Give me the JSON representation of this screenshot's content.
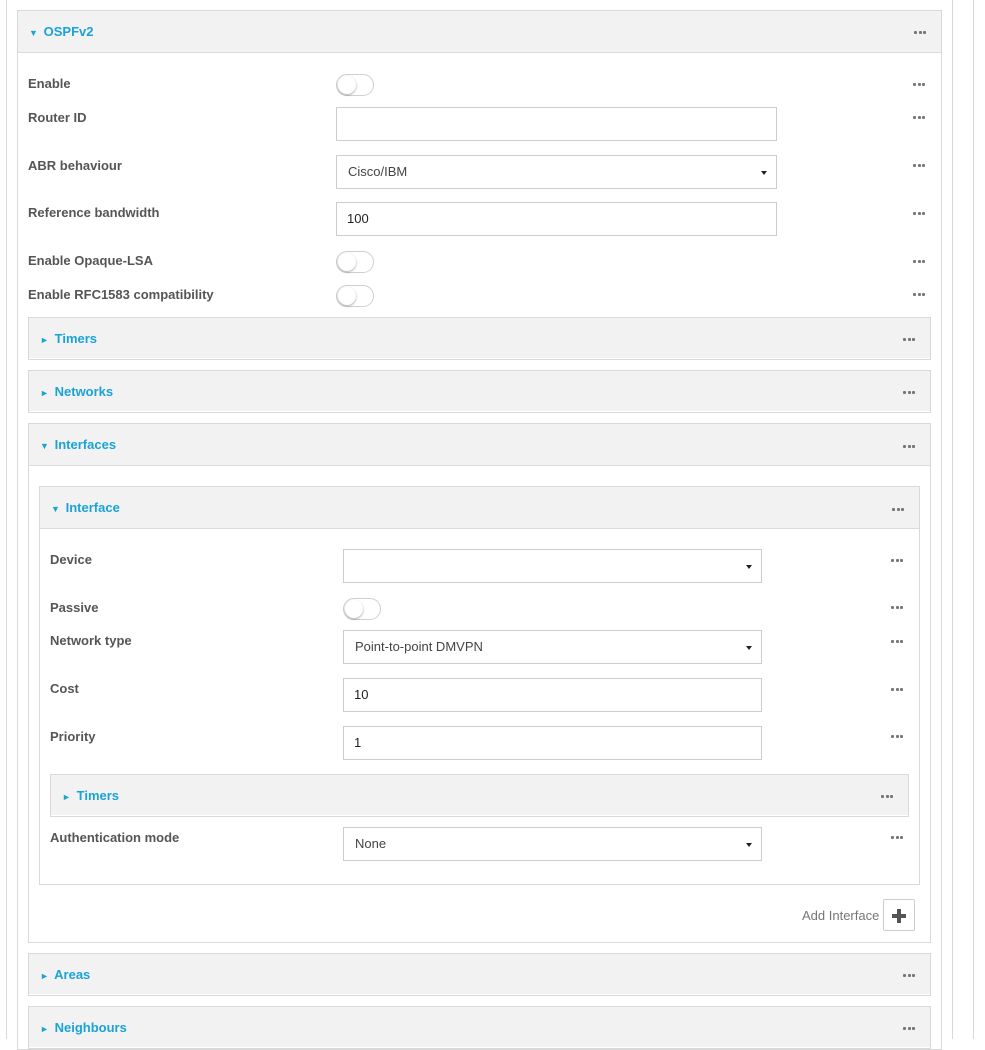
{
  "ospf": {
    "title": "OSPFv2",
    "fields": {
      "enable_label": "Enable",
      "router_id_label": "Router ID",
      "router_id_value": "",
      "abr_label": "ABR behaviour",
      "abr_value": "Cisco/IBM",
      "ref_bw_label": "Reference bandwidth",
      "ref_bw_value": "100",
      "opaque_label": "Enable Opaque-LSA",
      "rfc1583_label": "Enable RFC1583 compatibility"
    },
    "toggles": {
      "enable": false,
      "opaque": false,
      "rfc1583": false
    }
  },
  "sections": {
    "timers": "Timers",
    "networks": "Networks",
    "interfaces": "Interfaces",
    "areas": "Areas",
    "neighbours": "Neighbours"
  },
  "interface": {
    "title": "Interface",
    "device_label": "Device",
    "device_value": "",
    "passive_label": "Passive",
    "passive_on": false,
    "network_type_label": "Network type",
    "network_type_value": "Point-to-point DMVPN",
    "cost_label": "Cost",
    "cost_value": "10",
    "priority_label": "Priority",
    "priority_value": "1",
    "timers_label": "Timers",
    "auth_label": "Authentication mode",
    "auth_value": "None"
  },
  "add_interface_label": "Add Interface",
  "carets": {
    "expanded": "▼",
    "collapsed": "►"
  },
  "colors": {
    "accent": "#1aa3d9",
    "header_bg": "#f2f2f2",
    "border": "#d9d9d9"
  },
  "icons": {
    "more": "more-dots-icon",
    "add": "plus-icon",
    "dropdown": "caret-down-icon"
  }
}
